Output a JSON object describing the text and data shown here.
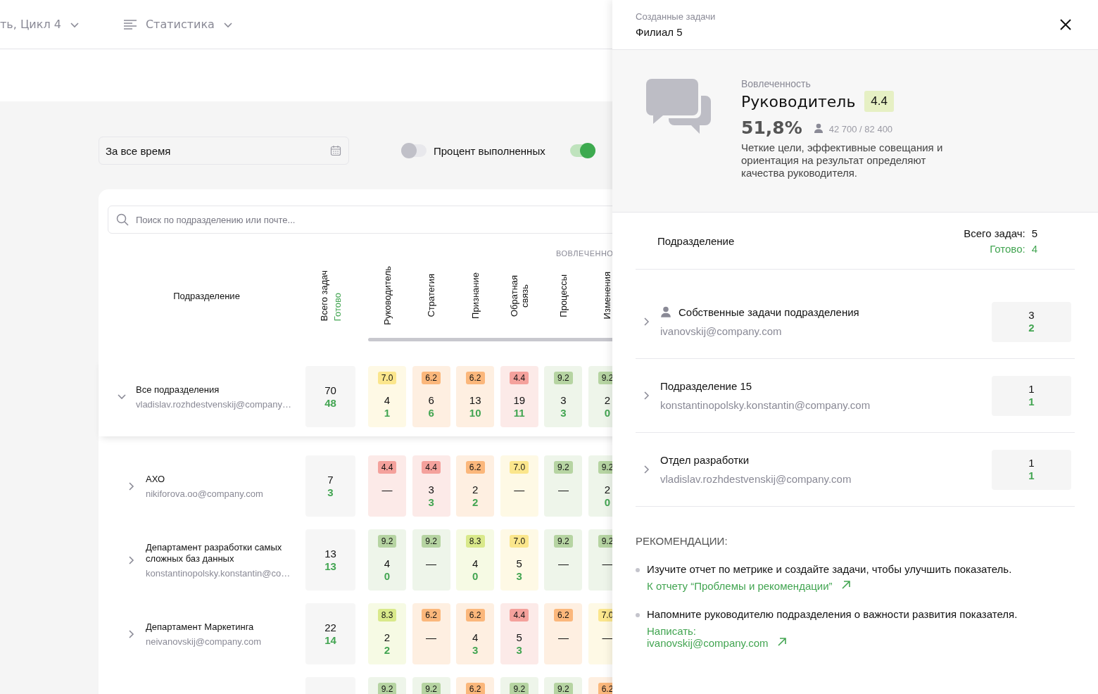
{
  "header": {
    "cycle": "ть, Цикл 4",
    "view": "Статистика"
  },
  "filters": {
    "period": "За все время",
    "toggles": [
      {
        "label": "Процент выполненных",
        "on": false
      },
      {
        "on": true
      }
    ]
  },
  "table": {
    "search_placeholder": "Поиск по подразделению или почте...",
    "group_label": "ВОВЛЕЧЕННО",
    "columns": {
      "unit": "Подразделение",
      "total": "Всего задач",
      "done": "Готово",
      "metrics": [
        "Руководитель",
        "Стратегия",
        "Признание",
        "Обратная связь",
        "Процессы",
        "Изменения"
      ]
    },
    "rows": [
      {
        "name": "Все подразделения",
        "email": "vladislav.rozhdestvenskij@company…",
        "expanded": true,
        "total": "70",
        "done": "48",
        "cells": [
          {
            "score": "7.0",
            "color": "#fbe68c",
            "total": "4",
            "done": "1"
          },
          {
            "score": "6.2",
            "color": "#fbb77b",
            "total": "6",
            "done": "6"
          },
          {
            "score": "6.2",
            "color": "#fbb77b",
            "total": "13",
            "done": "10"
          },
          {
            "score": "4.4",
            "color": "#f4a19c",
            "total": "19",
            "done": "11"
          },
          {
            "score": "9.2",
            "color": "#b6d4a2",
            "total": "3",
            "done": "3"
          },
          {
            "score": "9.2",
            "color": "#b6d4a2",
            "total": "2",
            "done": "0"
          }
        ],
        "children": [
          {
            "name": "АХО",
            "email": "nikiforova.oo@company.com",
            "expanded": false,
            "total": "7",
            "done": "3",
            "cells": [
              {
                "score": "4.4",
                "color": "#f4a19c",
                "total": "—"
              },
              {
                "score": "4.4",
                "color": "#f4a19c",
                "total": "3",
                "done": "3"
              },
              {
                "score": "6.2",
                "color": "#fbb77b",
                "total": "2",
                "done": "2"
              },
              {
                "score": "7.0",
                "color": "#fbe68c",
                "total": "—"
              },
              {
                "score": "9.2",
                "color": "#b6d4a2",
                "total": "—"
              },
              {
                "score": "9.2",
                "color": "#b6d4a2",
                "total": "2",
                "done": "0"
              }
            ]
          },
          {
            "name": "Департамент разработки самых сложных баз данных",
            "email": "konstantinopolsky.konstantin@co…",
            "expanded": false,
            "total": "13",
            "done": "13",
            "cells": [
              {
                "score": "9.2",
                "color": "#b6d4a2",
                "total": "4",
                "done": "0"
              },
              {
                "score": "9.2",
                "color": "#b6d4a2",
                "total": "—"
              },
              {
                "score": "8.3",
                "color": "#d9e98a",
                "total": "4",
                "done": "0"
              },
              {
                "score": "7.0",
                "color": "#fbe68c",
                "total": "5",
                "done": "3"
              },
              {
                "score": "9.2",
                "color": "#b6d4a2",
                "total": "—"
              },
              {
                "score": "9.2",
                "color": "#b6d4a2",
                "total": "—"
              }
            ]
          },
          {
            "name": "Департамент Маркетинга",
            "email": "neivanovskij@company.com",
            "expanded": false,
            "total": "22",
            "done": "14",
            "cells": [
              {
                "score": "8.3",
                "color": "#d9e98a",
                "total": "2",
                "done": "2"
              },
              {
                "score": "6.2",
                "color": "#fbb77b",
                "total": "—"
              },
              {
                "score": "6.2",
                "color": "#fbb77b",
                "total": "4",
                "done": "3"
              },
              {
                "score": "4.4",
                "color": "#f4a19c",
                "total": "5",
                "done": "3"
              },
              {
                "score": "6.2",
                "color": "#fbb77b",
                "total": "—"
              },
              {
                "score": "7.0",
                "color": "#fbe68c",
                "total": "—"
              }
            ]
          },
          {
            "cells": [
              {
                "score": "9.2",
                "color": "#b6d4a2"
              },
              {
                "score": "9.2",
                "color": "#b6d4a2"
              },
              {
                "score": "6.2",
                "color": "#fbb77b"
              },
              {
                "score": "9.2",
                "color": "#b6d4a2"
              },
              {
                "score": "9.2",
                "color": "#b6d4a2"
              },
              {
                "score": "6.2",
                "color": "#fbb77b"
              }
            ]
          }
        ]
      }
    ]
  },
  "panel": {
    "subtitle": "Созданные задачи",
    "title": "Филиал 5",
    "metric": {
      "group": "Вовлеченность",
      "name": "Руководитель",
      "score": "4.4",
      "color": "#e6f0c4",
      "percent": "51,8%",
      "respondents": "42 700 / 82 400",
      "description": "Четкие цели, эффективные совещания и ориентация на результат определяют качества руководителя."
    },
    "units": {
      "column": "Подразделение",
      "total_label": "Всего задач:",
      "total": "5",
      "done_label": "Готово:",
      "done": "4",
      "items": [
        {
          "kind": "own",
          "name": "Собственные задачи подразделения",
          "email": "ivanovskij@company.com",
          "total": "3",
          "done": "2"
        },
        {
          "kind": "unit",
          "name": "Подразделение 15",
          "email": "konstantinopolsky.konstantin@company.com",
          "total": "1",
          "done": "1"
        },
        {
          "kind": "unit",
          "name": "Отдел разработки",
          "email": "vladislav.rozhdestvenskij@company.com",
          "total": "1",
          "done": "1"
        }
      ]
    },
    "recommendations": {
      "title": "РЕКОМЕНДАЦИИ:",
      "items": [
        {
          "text": "Изучите отчет по метрике и создайте задачи, чтобы улучшить показатель.",
          "link": "К отчету “Проблемы и рекомендации”"
        },
        {
          "text": "Напомните руководителю подразделения о важности развития показателя.",
          "link": "Написать:\nivanovskij@company.com"
        }
      ]
    }
  }
}
